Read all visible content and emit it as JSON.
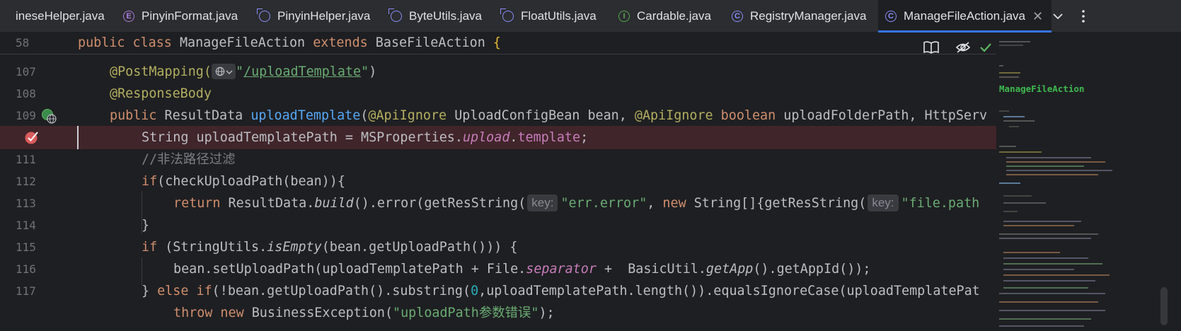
{
  "tabs": [
    {
      "label": "ineseHelper.java",
      "icon": "none"
    },
    {
      "label": "PinyinFormat.java",
      "icon": "enum"
    },
    {
      "label": "PinyinHelper.java",
      "icon": "class-abstract"
    },
    {
      "label": "ByteUtils.java",
      "icon": "class-abstract"
    },
    {
      "label": "FloatUtils.java",
      "icon": "class-abstract"
    },
    {
      "label": "Cardable.java",
      "icon": "interface"
    },
    {
      "label": "RegistryManager.java",
      "icon": "class"
    },
    {
      "label": "ManageFileAction.java",
      "icon": "class",
      "active": true
    }
  ],
  "tab_icons": {
    "enum": "E",
    "interface": "I",
    "class": "C"
  },
  "tab_close": "✕",
  "tab_menu": {
    "chevron": "⌄",
    "more": "⋮"
  },
  "sticky": {
    "line": "58",
    "kw1": "public",
    "kw2": "class",
    "name": "ManageFileAction",
    "kw3": "extends",
    "base": "BaseFileAction",
    "brace": "{"
  },
  "minimap_label": "ManageFileAction",
  "lines": {
    "n107": "107",
    "n108": "108",
    "n109": "109",
    "n111": "111",
    "n112": "112",
    "n113": "113",
    "n114": "114",
    "n115": "115",
    "n116": "116",
    "n117": "117"
  },
  "code": {
    "l107_ann": "@PostMapping(",
    "l107_url": "/uploadTemplate",
    "l108_ann": "@ResponseBody",
    "l109_kw": "public",
    "l109_type": " ResultData ",
    "l109_fn": "uploadTemplate",
    "l109_p1": "(",
    "l109_ann1": "@ApiIgnore",
    "l109_p2": " UploadConfigBean bean, ",
    "l109_ann2": "@ApiIgnore",
    "l109_kw2": " boolean",
    "l109_p3": " uploadFolderPath, HttpServ",
    "l110_a": "String uploadTemplatePath = MSProperties.",
    "l110_st": "upload",
    "l110_b": ".",
    "l110_fld": "template",
    "l110_c": ";",
    "l111_cmt": "//非法路径过滤",
    "l112_kw": "if",
    "l112_rest": "(checkUploadPath(bean)){",
    "l113_kw": "return",
    "l113_a": " ResultData.",
    "l113_it": "build",
    "l113_b": "().error(getResString(",
    "l113_hint1": "key:",
    "l113_str1": "\"err.error\"",
    "l113_c": ", ",
    "l113_kw2": "new",
    "l113_d": " String[]{getResString(",
    "l113_hint2": "key:",
    "l113_str2": "\"file.path",
    "l114": "}",
    "l115_kw": "if",
    "l115_a": " (StringUtils.",
    "l115_it": "isEmpty",
    "l115_b": "(bean.getUploadPath())) {",
    "l116_a": "bean.setUploadPath(uploadTemplatePath + File.",
    "l116_st": "separator",
    "l116_b": " +  BasicUtil.",
    "l116_it": "getApp",
    "l116_c": "().getAppId());",
    "l117_a": "} ",
    "l117_kw": "else if",
    "l117_b": "(!bean.getUploadPath().substring(",
    "l117_num": "0",
    "l117_c": ",uploadTemplatePath.length()).equalsIgnoreCase(uploadTemplatePat",
    "l118_kw": "throw new",
    "l118_a": " BusinessException(",
    "l118_str": "\"uploadPath参数错误\"",
    "l118_b": ");"
  }
}
